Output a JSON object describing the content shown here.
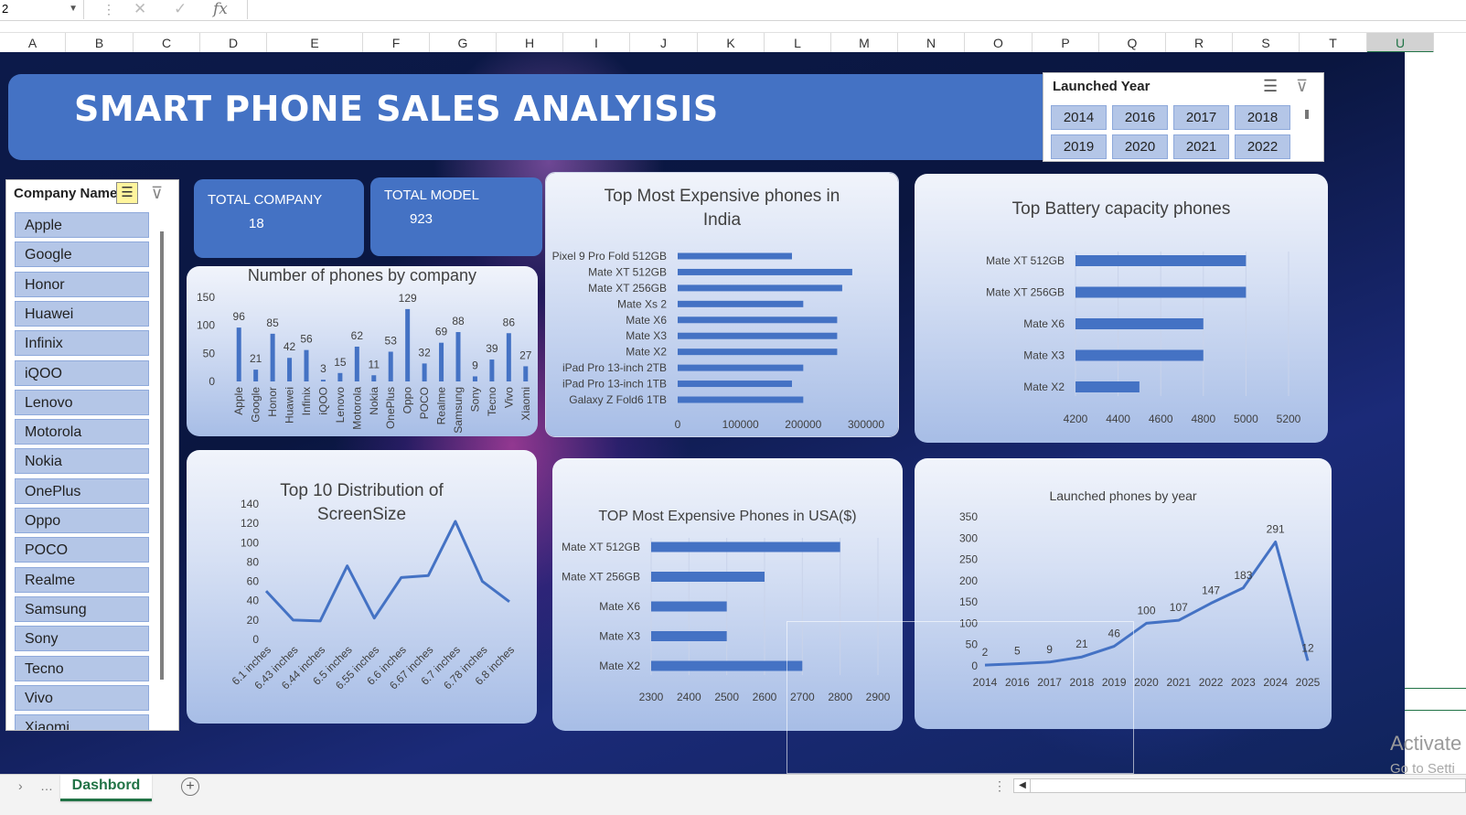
{
  "formula_bar": {
    "name_box": "2",
    "fx": "fx",
    "cancel_icon": "✕",
    "enter_icon": "✓"
  },
  "columns": [
    "A",
    "B",
    "C",
    "D",
    "E",
    "F",
    "G",
    "H",
    "I",
    "J",
    "K",
    "L",
    "M",
    "N",
    "O",
    "P",
    "Q",
    "R",
    "S",
    "T",
    "U"
  ],
  "dashboard": {
    "title": "SMART PHONE SALES ANALYISIS",
    "year_slicer": {
      "header": "Launched Year",
      "years": [
        "2014",
        "2016",
        "2017",
        "2018",
        "2019",
        "2020",
        "2021",
        "2022"
      ]
    },
    "company_slicer": {
      "header": "Company Name",
      "companies": [
        "Apple",
        "Google",
        "Honor",
        "Huawei",
        "Infinix",
        "iQOO",
        "Lenovo",
        "Motorola",
        "Nokia",
        "OnePlus",
        "Oppo",
        "POCO",
        "Realme",
        "Samsung",
        "Sony",
        "Tecno",
        "Vivo",
        "Xiaomi"
      ]
    },
    "kpis": [
      {
        "label": "TOTAL COMPANY",
        "value": "18"
      },
      {
        "label": "TOTAL MODEL",
        "value": "923"
      }
    ]
  },
  "chart_data": [
    {
      "id": "phones_by_company",
      "type": "bar",
      "title": "Number of phones by company",
      "categories": [
        "Apple",
        "Google",
        "Honor",
        "Huawei",
        "Infinix",
        "iQOO",
        "Lenovo",
        "Motorola",
        "Nokia",
        "OnePlus",
        "Oppo",
        "POCO",
        "Realme",
        "Samsung",
        "Sony",
        "Tecno",
        "Vivo",
        "Xiaomi"
      ],
      "values": [
        96,
        21,
        85,
        42,
        56,
        3,
        15,
        62,
        11,
        53,
        129,
        32,
        69,
        88,
        9,
        39,
        86,
        27
      ],
      "ylim": [
        0,
        150
      ],
      "yticks": [
        "0",
        "50",
        "100",
        "150"
      ],
      "data_labels": true
    },
    {
      "id": "expensive_india",
      "type": "bar",
      "orientation": "horizontal",
      "title": "Top  Most Expensive phones in India",
      "categories": [
        "Pixel 9 Pro Fold 512GB",
        "Mate XT 512GB",
        "Mate XT 256GB",
        "Mate Xs 2",
        "Mate X6",
        "Mate X3",
        "Mate X2",
        "iPad Pro 13-inch 2TB",
        "iPad Pro 13-inch 1TB",
        "Galaxy Z Fold6 1TB"
      ],
      "values": [
        182000,
        278000,
        262000,
        200000,
        254000,
        254000,
        254000,
        200000,
        182000,
        200000
      ],
      "xlim": [
        0,
        300000
      ],
      "xticks": [
        "0",
        "100000",
        "200000",
        "300000"
      ]
    },
    {
      "id": "battery",
      "type": "bar",
      "orientation": "horizontal",
      "title": "Top Battery capacity phones",
      "categories": [
        "Mate XT 512GB",
        "Mate XT 256GB",
        "Mate X6",
        "Mate X3",
        "Mate X2"
      ],
      "values": [
        5000,
        5000,
        4800,
        4800,
        4500
      ],
      "xlim": [
        4200,
        5200
      ],
      "xticks": [
        "4200",
        "4400",
        "4600",
        "4800",
        "5000",
        "5200"
      ]
    },
    {
      "id": "screen_size",
      "type": "line",
      "title": "Top 10 Distribution of ScreenSize",
      "categories": [
        "6.1 inches",
        "6.43 inches",
        "6.44 inches",
        "6.5 inches",
        "6.55 inches",
        "6.6 inches",
        "6.67 inches",
        "6.7 inches",
        "6.78 inches",
        "6.8 inches"
      ],
      "values": [
        50,
        20,
        19,
        76,
        22,
        64,
        66,
        122,
        60,
        39
      ],
      "ylim": [
        0,
        140
      ],
      "yticks": [
        "0",
        "20",
        "40",
        "60",
        "80",
        "100",
        "120",
        "140"
      ]
    },
    {
      "id": "expensive_usa",
      "type": "bar",
      "orientation": "horizontal",
      "title": "TOP Most Expensive Phones in USA($)",
      "categories": [
        "Mate XT 512GB",
        "Mate XT 256GB",
        "Mate X6",
        "Mate X3",
        "Mate X2"
      ],
      "values": [
        2800,
        2600,
        2500,
        2500,
        2700
      ],
      "xlim": [
        2300,
        2900
      ],
      "xticks": [
        "2300",
        "2400",
        "2500",
        "2600",
        "2700",
        "2800",
        "2900"
      ]
    },
    {
      "id": "launched_by_year",
      "type": "line",
      "title": "Launched phones by year",
      "categories": [
        "2014",
        "2016",
        "2017",
        "2018",
        "2019",
        "2020",
        "2021",
        "2022",
        "2023",
        "2024",
        "2025"
      ],
      "values": [
        2,
        5,
        9,
        21,
        46,
        100,
        107,
        147,
        183,
        291,
        12
      ],
      "ylim": [
        0,
        350
      ],
      "yticks": [
        "0",
        "50",
        "100",
        "150",
        "200",
        "250",
        "300",
        "350"
      ],
      "data_labels": true
    }
  ],
  "sheet_tab": "Dashbord",
  "watermark": {
    "line1": "Activate",
    "line2": "Go to Setti"
  },
  "colors": {
    "accent": "#4472c4",
    "slicer_button": "#b4c6e7",
    "excel_green": "#217346"
  }
}
